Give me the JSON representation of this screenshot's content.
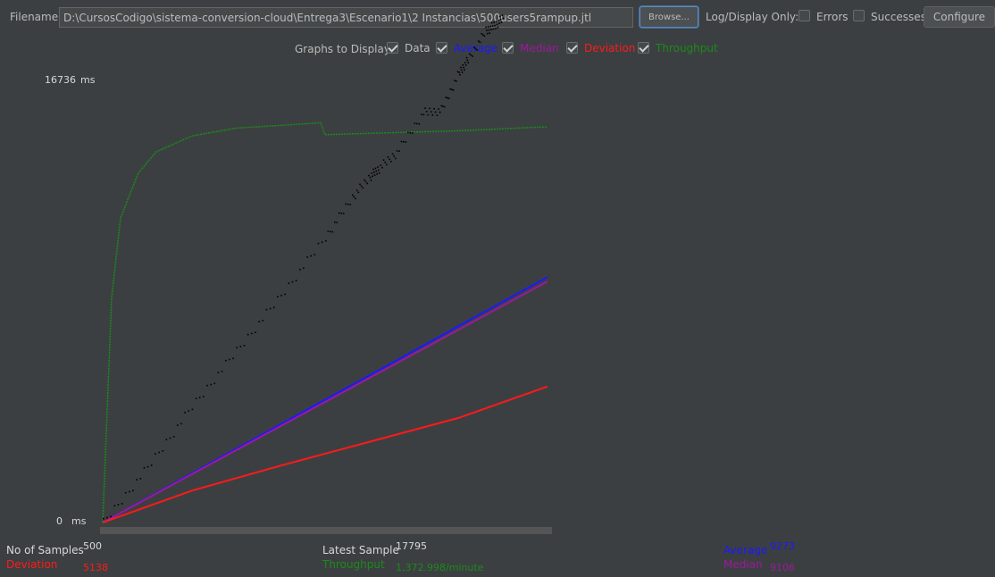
{
  "toolbar": {
    "filename_label": "Filename",
    "filename_value": "D:\\CursosCodigo\\sistema-conversion-cloud\\Entrega3\\Escenario1\\2 Instancias\\500users5rampup.jtl",
    "browse_label": "Browse...",
    "log_display_label": "Log/Display Only:",
    "errors_label": "Errors",
    "errors_checked": false,
    "successes_label": "Successes",
    "successes_checked": false,
    "configure_label": "Configure"
  },
  "graphs_to_display": {
    "label": "Graphs to Display",
    "items": [
      {
        "label": "Data",
        "checked": true,
        "color": "#e0e0e0"
      },
      {
        "label": "Average",
        "checked": true,
        "color": "#1a1aff"
      },
      {
        "label": "Median",
        "checked": true,
        "color": "#9b1a9b"
      },
      {
        "label": "Deviation",
        "checked": true,
        "color": "#ff1a1a"
      },
      {
        "label": "Throughput",
        "checked": true,
        "color": "#1a8a1a"
      }
    ]
  },
  "chart_data": {
    "type": "line",
    "y_max_label": "16736",
    "y_min_label": "0",
    "y_unit": "ms",
    "ylim": [
      0,
      16736
    ],
    "samples": 500,
    "series": [
      {
        "name": "Average",
        "color": "#1a1aff",
        "x": [
          0,
          500
        ],
        "values": [
          0,
          9273
        ]
      },
      {
        "name": "Median",
        "color": "#9b1a9b",
        "x": [
          0,
          500
        ],
        "values": [
          0,
          9106
        ]
      },
      {
        "name": "Deviation",
        "color": "#ff1a1a",
        "x": [
          0,
          100,
          200,
          300,
          400,
          500
        ],
        "values": [
          0,
          1200,
          2150,
          3050,
          3950,
          5138
        ]
      },
      {
        "name": "Throughput",
        "color": "#1a8a1a",
        "x": [
          0,
          10,
          20,
          40,
          60,
          100,
          150,
          200,
          245,
          250,
          300,
          400,
          500
        ],
        "values": [
          0,
          8500,
          11500,
          13200,
          14000,
          14600,
          14900,
          15000,
          15100,
          14650,
          14700,
          14800,
          14950
        ]
      },
      {
        "name": "Data",
        "color": "#000000",
        "x": [
          0,
          50,
          100,
          150,
          200,
          250,
          280,
          300,
          310,
          330,
          360,
          380,
          400,
          410,
          430,
          440,
          450
        ],
        "values": [
          0,
          2100,
          4400,
          6500,
          8600,
          10800,
          12300,
          13100,
          13400,
          14000,
          15500,
          15600,
          17000,
          17500,
          18600,
          18800,
          19100
        ]
      }
    ]
  },
  "footer": {
    "samples_label": "No of Samples",
    "samples_value": "500",
    "deviation_label": "Deviation",
    "deviation_value": "5138",
    "latest_label": "Latest Sample",
    "latest_value": "17795",
    "throughput_label": "Throughput",
    "throughput_value": "1,372.998/minute",
    "average_label": "Average",
    "average_value": "9273",
    "median_label": "Median",
    "median_value": "9106"
  },
  "colors": {
    "background": "#3c3f41",
    "average": "#1a1aff",
    "median": "#9b1a9b",
    "deviation": "#ff1a1a",
    "throughput": "#1a8a1a",
    "data": "#000000"
  }
}
